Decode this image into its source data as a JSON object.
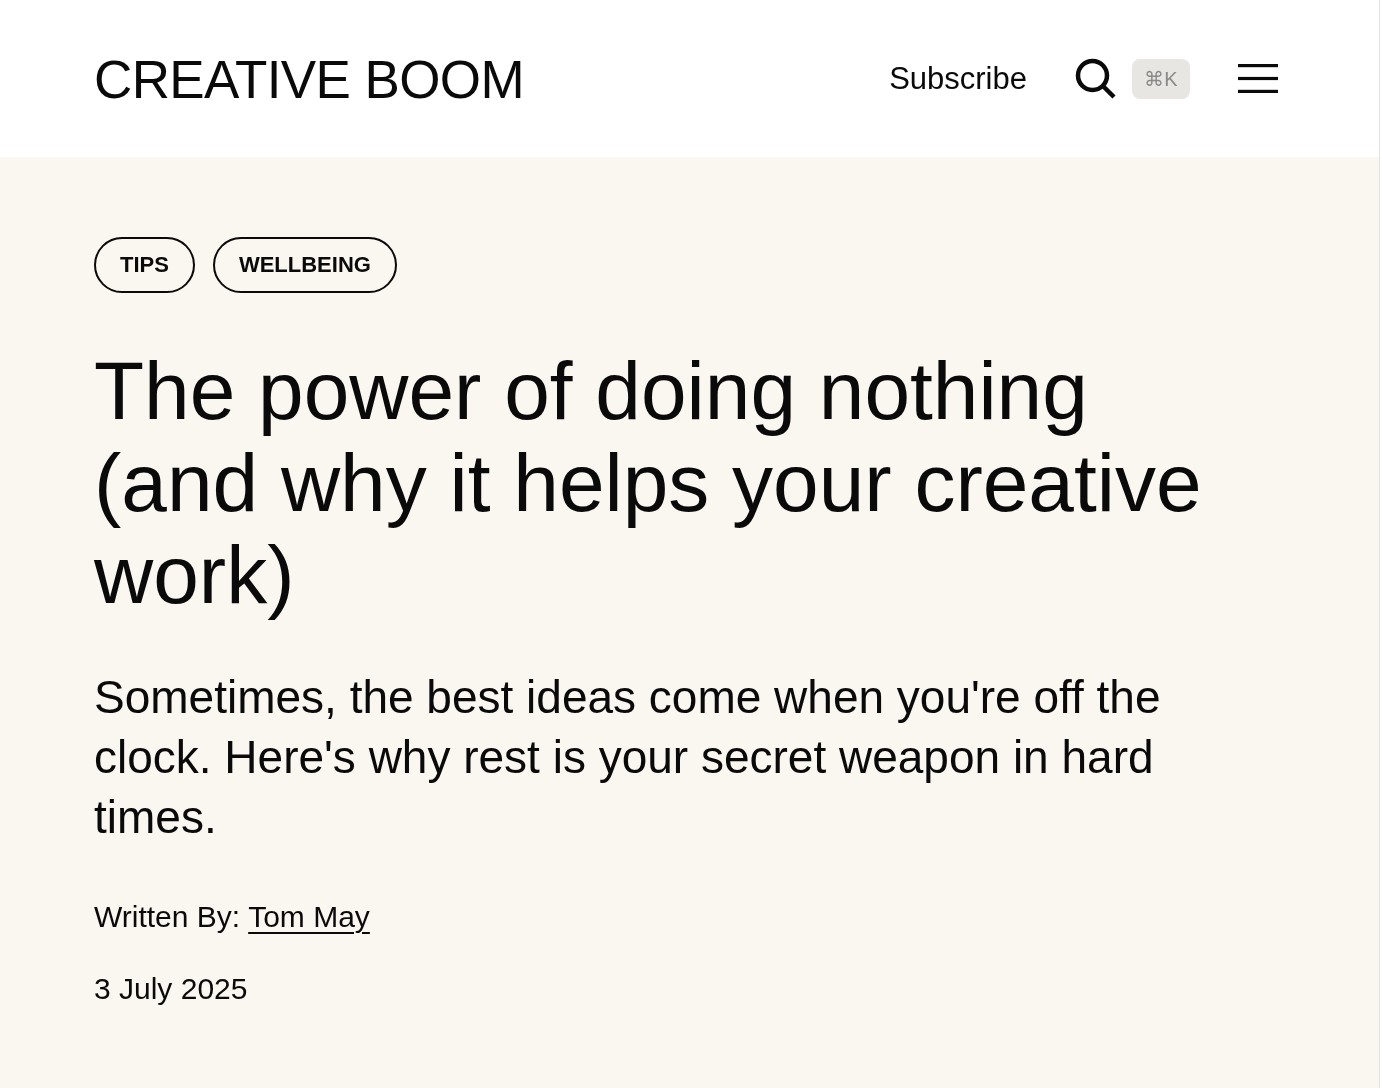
{
  "header": {
    "logo": "CREATIVE BOOM",
    "subscribe": "Subscribe",
    "search_shortcut": "⌘K"
  },
  "article": {
    "tags": [
      "TIPS",
      "WELLBEING"
    ],
    "title": "The power of doing nothing (and why it helps your creative work)",
    "standfirst": "Sometimes, the best ideas come when you're off the clock. Here's why rest is your secret weapon in hard times.",
    "byline": {
      "label": "Written By:",
      "author": "Tom May"
    },
    "date": "3 July 2025"
  }
}
